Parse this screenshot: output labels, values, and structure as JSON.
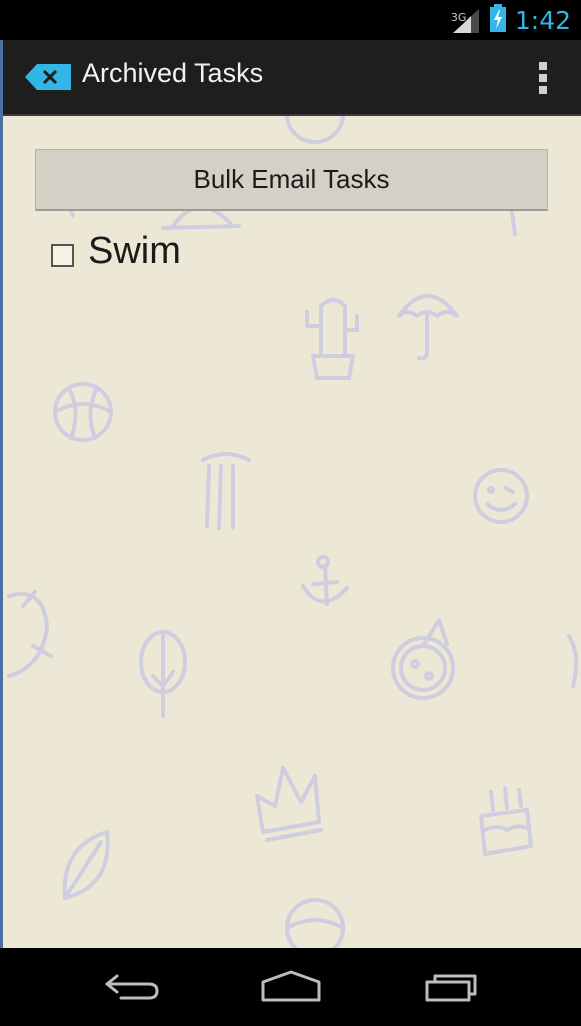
{
  "status_bar": {
    "network_type": "3G",
    "time": "1:42",
    "icons": [
      "signal-icon",
      "battery-charging-icon"
    ]
  },
  "action_bar": {
    "title": "Archived Tasks",
    "app_icon": "archive-delete-icon",
    "overflow_icon": "overflow-menu-icon"
  },
  "content": {
    "bulk_button_label": "Bulk Email Tasks",
    "tasks": [
      {
        "label": "Swim",
        "checked": false
      }
    ]
  },
  "nav_bar": {
    "buttons": [
      "back-icon",
      "home-icon",
      "recent-apps-icon"
    ]
  },
  "colors": {
    "accent": "#33b5e5",
    "background": "#ede8d6",
    "action_bar": "#1e1e1e"
  }
}
